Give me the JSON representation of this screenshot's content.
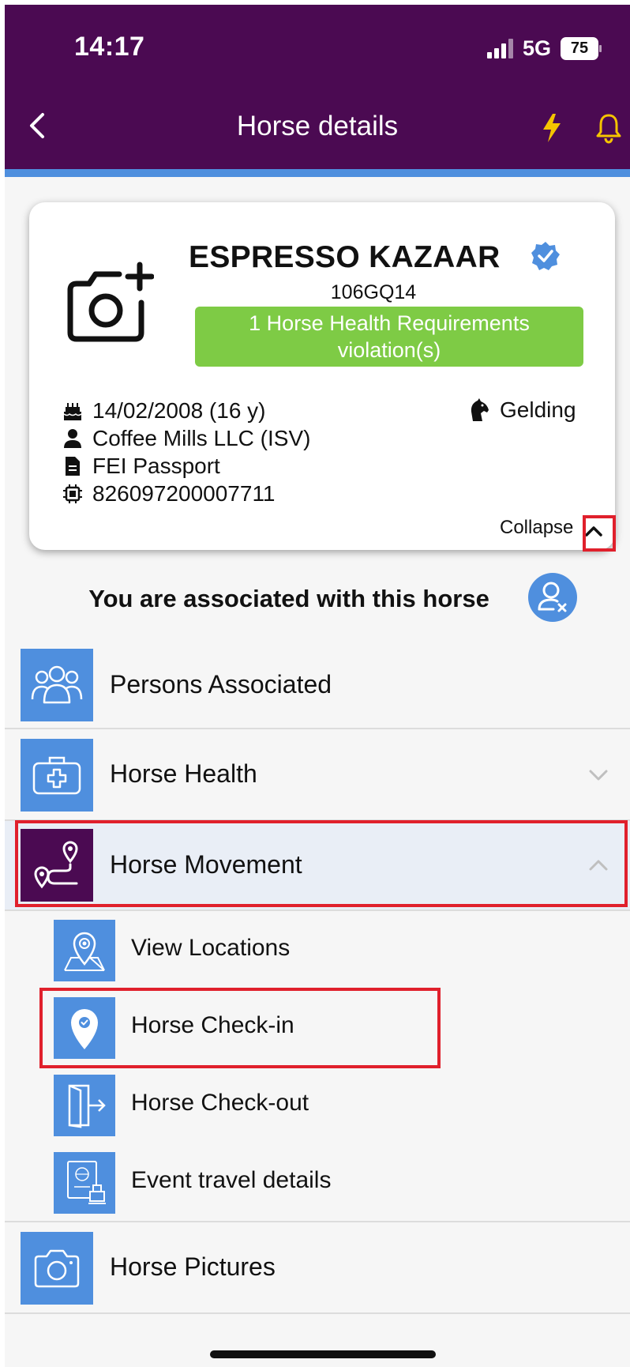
{
  "status_bar": {
    "time": "14:17",
    "network": "5G",
    "battery": "75"
  },
  "header": {
    "title": "Horse details"
  },
  "horse": {
    "name": "ESPRESSO KAZAAR",
    "id": "106GQ14",
    "violation_line1": "1 Horse Health Requirements",
    "violation_line2": "violation(s)",
    "birth": "14/02/2008 (16 y)",
    "owner": "Coffee Mills LLC (ISV)",
    "passport": "FEI Passport",
    "chip": "826097200007711",
    "sex": "Gelding",
    "collapse_label": "Collapse"
  },
  "association": {
    "text": "You are associated with this horse"
  },
  "menu": {
    "persons": "Persons Associated",
    "health": "Horse Health",
    "movement": "Horse Movement",
    "pictures": "Horse Pictures",
    "sub": {
      "view_locations": "View Locations",
      "checkin": "Horse Check-in",
      "checkout": "Horse Check-out",
      "travel": "Event travel details"
    }
  },
  "colors": {
    "header_bg": "#4b0a52",
    "accent_blue": "#4f8fde",
    "violation_green": "#7ecb45",
    "highlight_red": "#e0202c",
    "icon_yellow": "#f5c400",
    "active_row_bg": "#e9eef6"
  },
  "icons": [
    "chevron-left-icon",
    "bolt-icon",
    "bell-icon",
    "camera-plus-icon",
    "verified-badge-icon",
    "birthday-cake-icon",
    "person-icon",
    "document-icon",
    "chip-icon",
    "horse-head-icon",
    "chevron-up-icon",
    "user-remove-icon",
    "people-group-icon",
    "medical-kit-icon",
    "route-pin-icon",
    "map-pin-icon",
    "check-pin-icon",
    "exit-door-icon",
    "passport-icon",
    "camera-icon",
    "chevron-down-icon"
  ]
}
